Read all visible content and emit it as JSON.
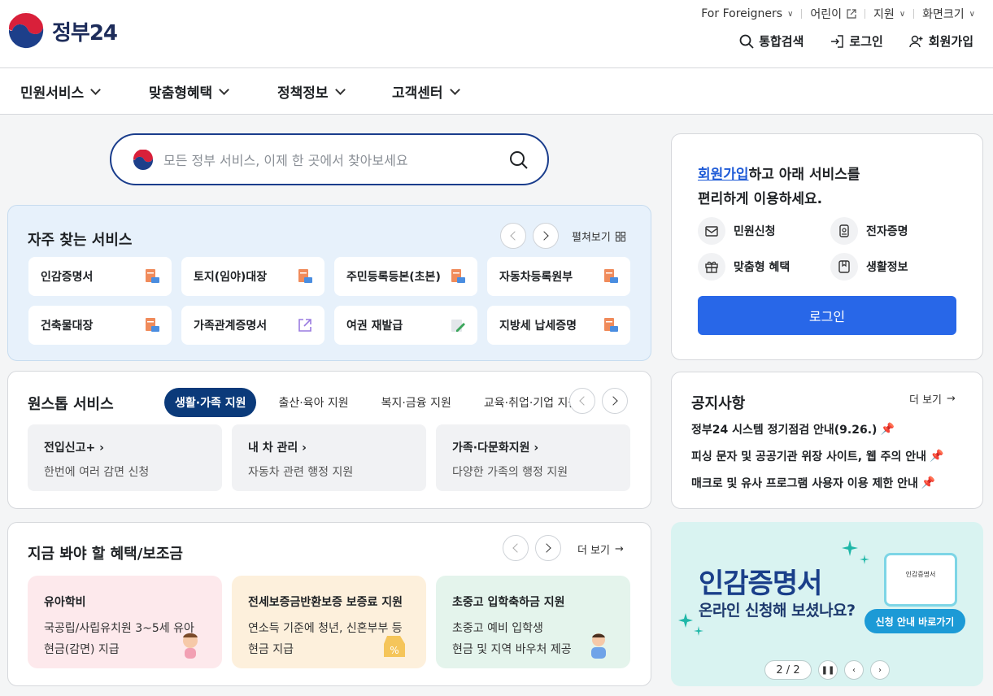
{
  "header": {
    "logo_text": "정부24",
    "util": [
      {
        "label": "For Foreigners"
      },
      {
        "label": "어린이"
      },
      {
        "label": "지원"
      },
      {
        "label": "화면크기"
      }
    ],
    "topnav": {
      "search": "통합검색",
      "login": "로그인",
      "signup": "회원가입"
    }
  },
  "gnb": [
    {
      "label": "민원서비스"
    },
    {
      "label": "맞춤형혜택"
    },
    {
      "label": "정책정보"
    },
    {
      "label": "고객센터"
    }
  ],
  "search": {
    "placeholder": "모든 정부 서비스, 이제 한 곳에서 찾아보세요"
  },
  "frequent": {
    "title": "자주 찾는 서비스",
    "expand_label": "펼쳐보기",
    "items": [
      {
        "label": "인감증명서",
        "icon": "document-print-icon"
      },
      {
        "label": "토지(임야)대장",
        "icon": "document-print-icon"
      },
      {
        "label": "주민등록등본(초본)",
        "icon": "document-print-icon"
      },
      {
        "label": "자동차등록원부",
        "icon": "document-print-icon"
      },
      {
        "label": "건축물대장",
        "icon": "document-print-icon"
      },
      {
        "label": "가족관계증명서",
        "icon": "external-link-icon"
      },
      {
        "label": "여권 재발급",
        "icon": "edit-form-icon"
      },
      {
        "label": "지방세 납세증명",
        "icon": "document-print-icon"
      }
    ]
  },
  "onestop": {
    "title": "원스톱 서비스",
    "tabs": [
      "생활·가족 지원",
      "출산·육아 지원",
      "복지·금융 지원",
      "교육·취업·기업 지원"
    ],
    "active_tab": 0,
    "items": [
      {
        "title": "전입신고+",
        "desc": "한번에 여러 감면 신청"
      },
      {
        "title": "내 차 관리",
        "desc": "자동차 관련 행정 지원"
      },
      {
        "title": "가족·다문화지원",
        "desc": "다양한 가족의 행정 지원"
      }
    ]
  },
  "benefits": {
    "title": "지금 봐야 할 혜택/보조금",
    "more_label": "더 보기",
    "items": [
      {
        "title": "유아학비",
        "line1": "국공립/사립유치원 3~5세 유아",
        "line2": "현금(감면) 지급",
        "bg": "#fde9ec"
      },
      {
        "title": "전세보증금반환보증 보증료 지원",
        "line1": "연소득 기준에 청년, 신혼부부 등",
        "line2": "현금 지급",
        "bg": "#fdf0dc"
      },
      {
        "title": "초중고 입학축하금 지원",
        "line1": "초중고 예비 입학생",
        "line2": "현금 및 지역 바우처 제공",
        "bg": "#e4f4ec"
      }
    ]
  },
  "login_panel": {
    "msg_highlight": "회원가입",
    "msg_rest1": "하고 아래 서비스를",
    "msg_line2": "편리하게 이용하세요.",
    "services": [
      {
        "label": "민원신청",
        "icon": "mail-icon"
      },
      {
        "label": "전자증명",
        "icon": "id-card-icon"
      },
      {
        "label": "맞춤형 혜택",
        "icon": "gift-icon"
      },
      {
        "label": "생활정보",
        "icon": "bookmark-icon"
      }
    ],
    "button": "로그인"
  },
  "notice": {
    "title": "공지사항",
    "more_label": "더 보기",
    "items": [
      {
        "label": "정부24 시스템 정기점검 안내(9.26.)"
      },
      {
        "label": "피싱 문자 및 공공기관 위장 사이트, 웹 주의 안내"
      },
      {
        "label": "매크로 및 유사 프로그램 사용자 이용 제한 안내"
      }
    ]
  },
  "banner": {
    "headline": "인감증명서",
    "subline": "온라인 신청해 보셨나요?",
    "button": "신청 안내 바로가기",
    "card_text": "인감증명서",
    "counter": "2 / 2"
  },
  "colors": {
    "primary_button": "#2867e8",
    "active_tab": "#0b3a7a",
    "frequent_bg": "#e7f1fb",
    "banner_bg": "#d9f3f1"
  }
}
